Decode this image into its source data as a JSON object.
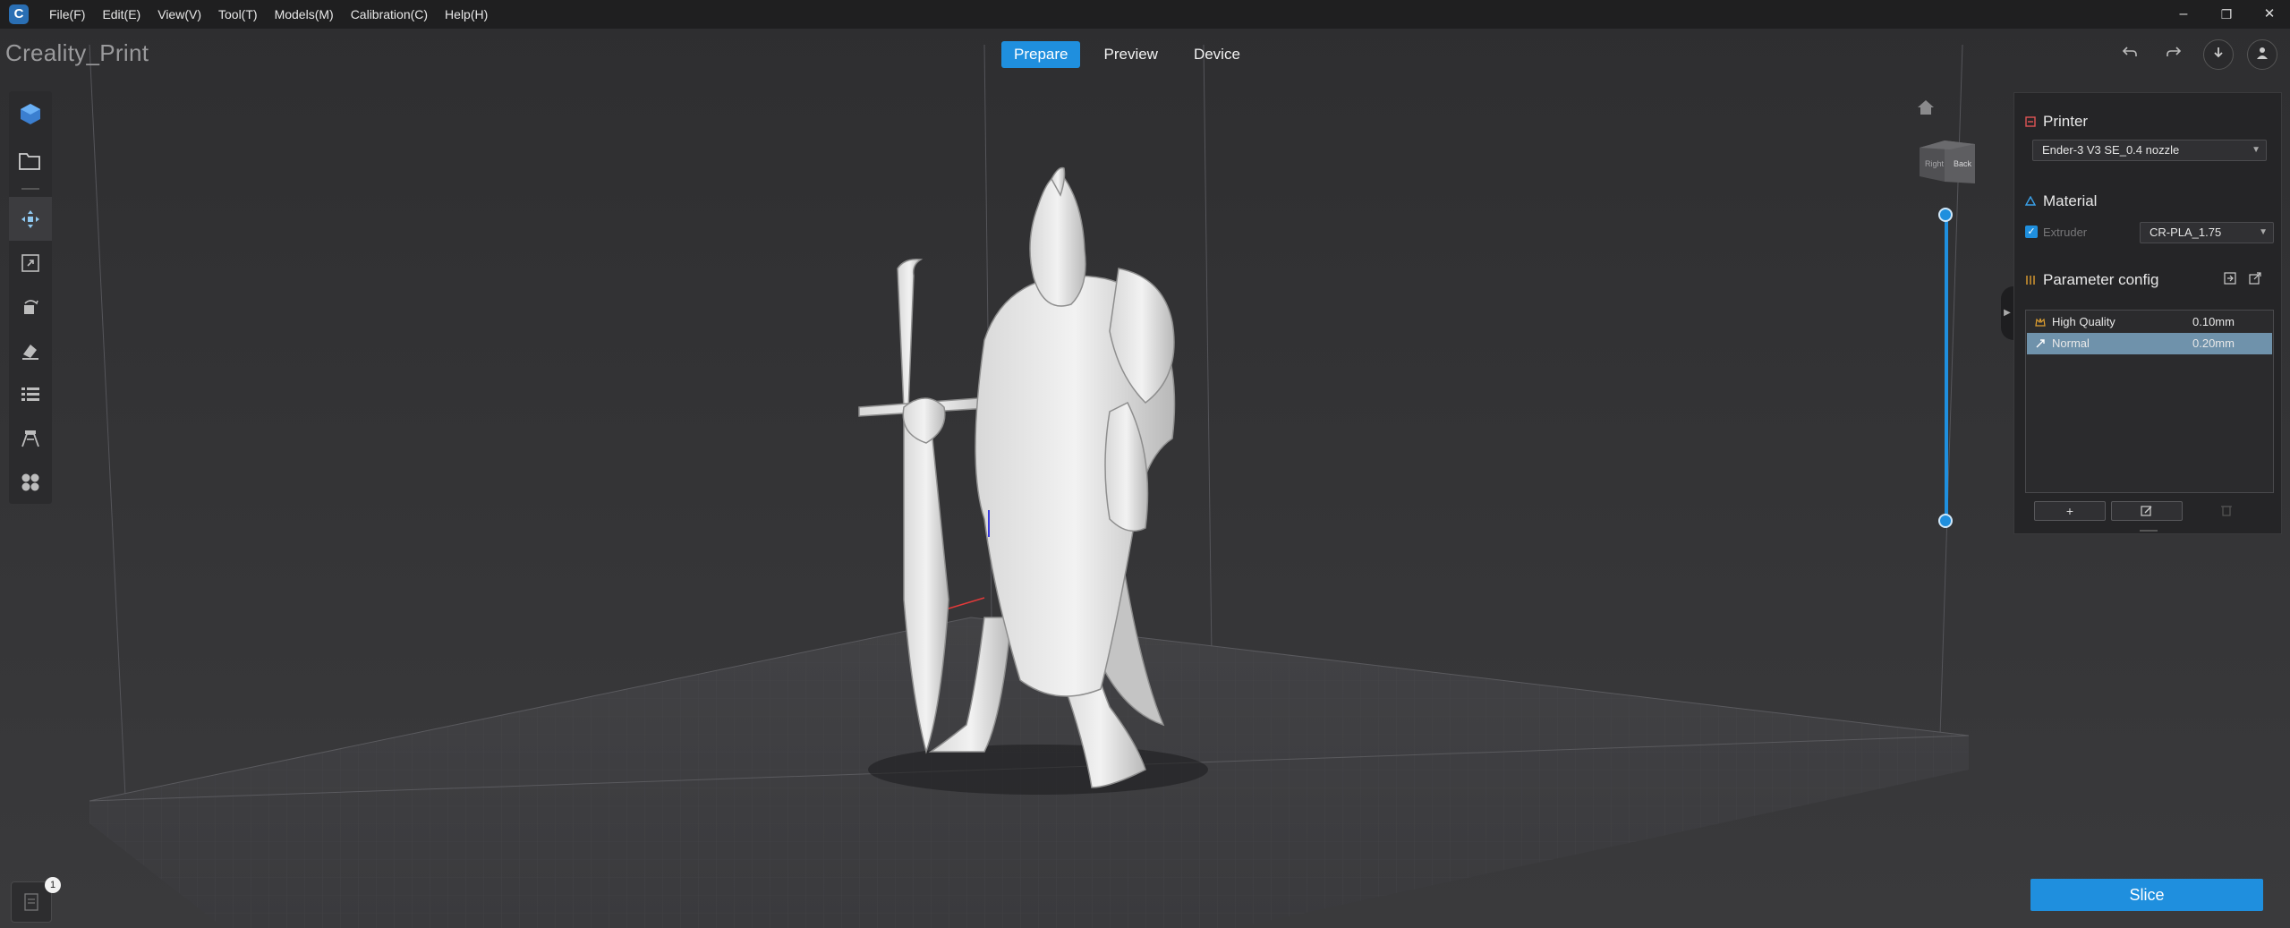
{
  "window": {
    "menu": [
      "File(F)",
      "Edit(E)",
      "View(V)",
      "Tool(T)",
      "Models(M)",
      "Calibration(C)",
      "Help(H)"
    ],
    "controls": {
      "minimize": "–",
      "restore": "❐",
      "close": "✕"
    }
  },
  "header": {
    "app_title": "Creality_Print",
    "tabs": [
      {
        "label": "Prepare",
        "active": true
      },
      {
        "label": "Preview",
        "active": false
      },
      {
        "label": "Device",
        "active": false
      }
    ]
  },
  "left_toolbar": {
    "tools": [
      "add-model-icon",
      "open-file-icon",
      "move-icon",
      "scale-icon",
      "rotate-icon",
      "paint-icon",
      "layers-list-icon",
      "support-icon",
      "arrange-icon"
    ]
  },
  "view": {
    "cube_faces": [
      "Right",
      "Back"
    ]
  },
  "right_panel": {
    "printer": {
      "title": "Printer",
      "selected": "Ender-3 V3 SE_0.4 nozzle"
    },
    "material": {
      "title": "Material",
      "extruder_label": "Extruder",
      "extruder_checked": true,
      "selected": "CR-PLA_1.75"
    },
    "parameter_config": {
      "title": "Parameter config",
      "profiles": [
        {
          "name": "High Quality",
          "value": "0.10mm",
          "selected": false
        },
        {
          "name": "Normal",
          "value": "0.20mm",
          "selected": true
        }
      ],
      "add_label": "+"
    }
  },
  "footer": {
    "slice_label": "Slice",
    "log_badge": "1"
  },
  "colors": {
    "accent": "#1f8fde",
    "panel": "#252527",
    "background": "#333335",
    "selected_row": "#6f92ab"
  }
}
